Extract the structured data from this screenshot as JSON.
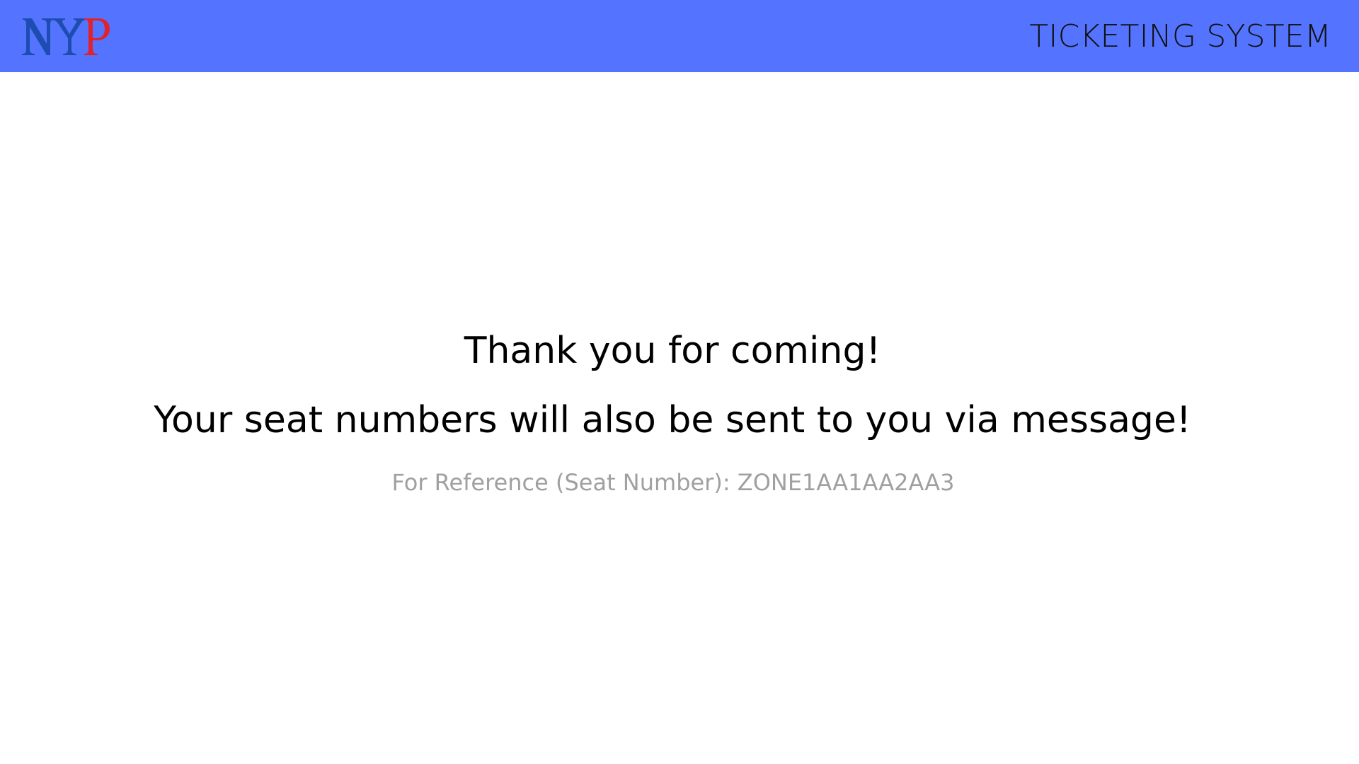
{
  "header": {
    "logo_text": "NYP",
    "system_title": "TICKETING SYSTEM"
  },
  "main": {
    "thanks_message": "Thank you for coming!",
    "seat_message": "Your seat numbers will also be sent to you via message!",
    "reference_text": "For Reference (Seat Number): ZONE1AA1AA2AA3"
  },
  "colors": {
    "header_background": "#5473ff",
    "logo_blue": "#1d4db1",
    "logo_red": "#e2222b",
    "reference_text": "#a0a0a0"
  },
  "icons": {
    "logo": "nyp-logo"
  }
}
